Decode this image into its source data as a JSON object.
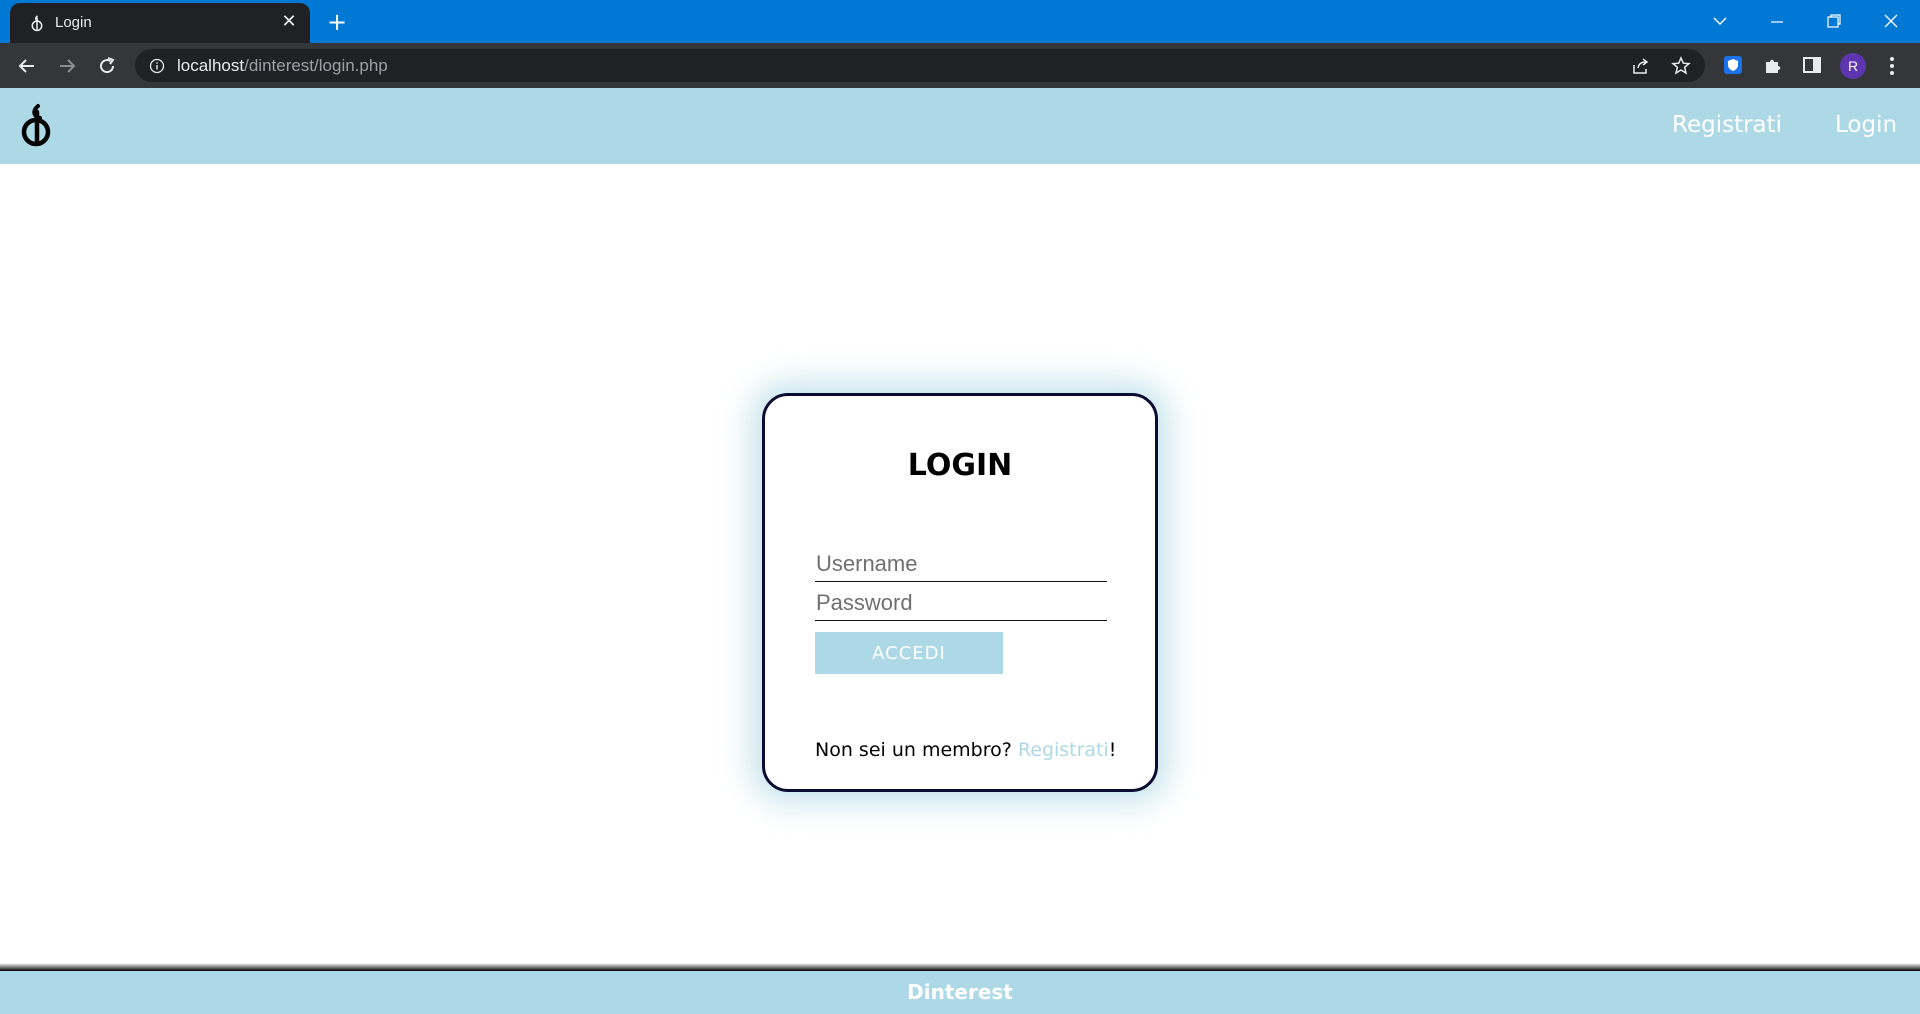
{
  "browser": {
    "tab_title": "Login",
    "url_host": "localhost",
    "url_path": "/dinterest/login.php",
    "profile_initial": "R",
    "theme_color": "#0078d4"
  },
  "header": {
    "nav": [
      {
        "label": "Registrati"
      },
      {
        "label": "Login"
      }
    ],
    "background": "#add8e6",
    "logo_icon": "flame-logo-icon"
  },
  "login": {
    "title": "LOGIN",
    "username_placeholder": "Username",
    "password_placeholder": "Password",
    "submit_label": "ACCEDI",
    "signup_prompt": "Non sei un membro? ",
    "signup_link": "Registrati",
    "signup_suffix": "!"
  },
  "footer": {
    "brand": "Dinterest"
  }
}
